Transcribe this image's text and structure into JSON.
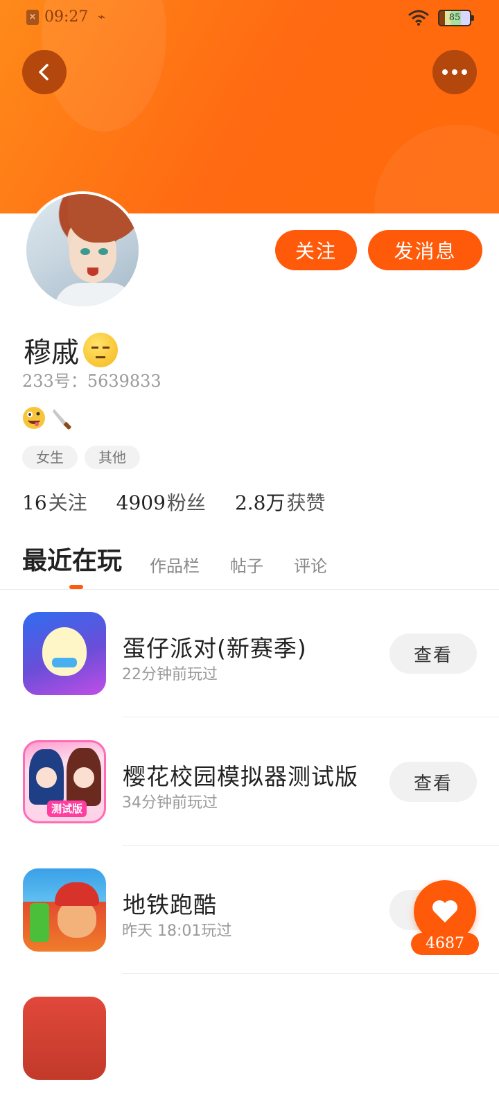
{
  "status_bar": {
    "time": "09:27",
    "battery": "85"
  },
  "profile": {
    "name": "穆戚",
    "uid_label": "233号：",
    "uid": "5639833",
    "bio_icons": [
      "zany-face-icon",
      "knife-icon"
    ],
    "tags": [
      "女生",
      "其他"
    ],
    "follow_label": "关注",
    "message_label": "发消息"
  },
  "stats": [
    {
      "value": "16",
      "label": "关注"
    },
    {
      "value": "4909",
      "label": "粉丝"
    },
    {
      "value": "2.8万",
      "label": "获赞"
    }
  ],
  "tabs": [
    "最近在玩",
    "作品栏",
    "帖子",
    "评论"
  ],
  "games": [
    {
      "title": "蛋仔派对(新赛季)",
      "played": "22分钟前玩过",
      "action": "查看"
    },
    {
      "title": "樱花校园模拟器测试版",
      "played": "34分钟前玩过",
      "action": "查看",
      "icon_badge": "测试版"
    },
    {
      "title": "地铁跑酷",
      "played": "昨天 18:01玩过",
      "action": ""
    }
  ],
  "like_fab": {
    "count": "4687"
  },
  "colors": {
    "accent": "#ff5a0a",
    "banner": "#ff6a12"
  }
}
